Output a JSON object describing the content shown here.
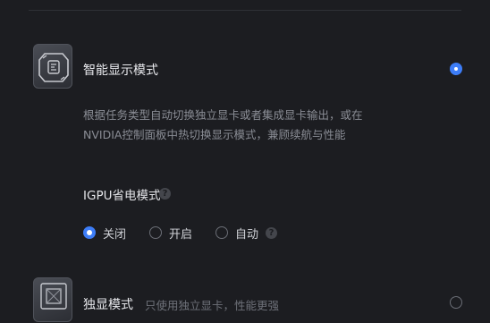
{
  "smart_mode": {
    "title": "智能显示模式",
    "icon": "gpu-switch-icon",
    "selected": true,
    "description": "根据任务类型自动切换独立显卡或者集成显卡输出，或在NVIDIA控制面板中热切换显示模式，兼顾续航与性能"
  },
  "igpu_power": {
    "title": "IGPU省电模式",
    "help_icon": "?",
    "options": [
      {
        "label": "关闭",
        "selected": true
      },
      {
        "label": "开启",
        "selected": false
      },
      {
        "label": "自动",
        "selected": false
      }
    ]
  },
  "discrete_mode": {
    "title": "独显模式",
    "icon": "gpu-chip-icon",
    "description": "只使用独立显卡，性能更强",
    "selected": false
  },
  "colors": {
    "accent": "#3d7df7",
    "background": "#1c1d21"
  }
}
